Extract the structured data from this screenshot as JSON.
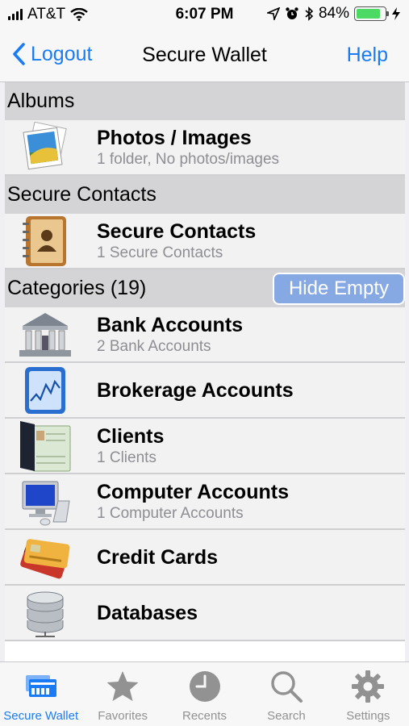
{
  "status_bar": {
    "carrier": "AT&T",
    "time": "6:07 PM",
    "battery_percent": "84%",
    "battery_level": 0.84
  },
  "nav": {
    "back_label": "Logout",
    "title": "Secure Wallet",
    "help_label": "Help"
  },
  "sections": {
    "albums": {
      "header": "Albums",
      "rows": [
        {
          "title": "Photos / Images",
          "subtitle": "1 folder, No photos/images",
          "icon": "photos-icon"
        }
      ]
    },
    "contacts": {
      "header": "Secure Contacts",
      "rows": [
        {
          "title": "Secure Contacts",
          "subtitle": "1 Secure Contacts",
          "icon": "contacts-book-icon"
        }
      ]
    },
    "categories": {
      "header": "Categories (19)",
      "hide_empty_label": "Hide Empty",
      "rows": [
        {
          "title": "Bank Accounts",
          "subtitle": "2 Bank Accounts",
          "icon": "bank-icon"
        },
        {
          "title": "Brokerage Accounts",
          "subtitle": "",
          "icon": "stock-chart-icon"
        },
        {
          "title": "Clients",
          "subtitle": "1 Clients",
          "icon": "client-folder-icon"
        },
        {
          "title": "Computer Accounts",
          "subtitle": "1 Computer Accounts",
          "icon": "computer-icon"
        },
        {
          "title": "Credit Cards",
          "subtitle": "",
          "icon": "credit-card-icon"
        },
        {
          "title": "Databases",
          "subtitle": "",
          "icon": "database-icon"
        }
      ]
    }
  },
  "tabs": [
    {
      "label": "Secure Wallet",
      "icon": "wallet-icon",
      "active": true
    },
    {
      "label": "Favorites",
      "icon": "star-icon",
      "active": false
    },
    {
      "label": "Recents",
      "icon": "clock-icon",
      "active": false
    },
    {
      "label": "Search",
      "icon": "search-icon",
      "active": false
    },
    {
      "label": "Settings",
      "icon": "gear-icon",
      "active": false
    }
  ],
  "colors": {
    "accent": "#1a7cf5",
    "hide_empty_bg": "#86a9e3",
    "battery": "#4cd964"
  }
}
